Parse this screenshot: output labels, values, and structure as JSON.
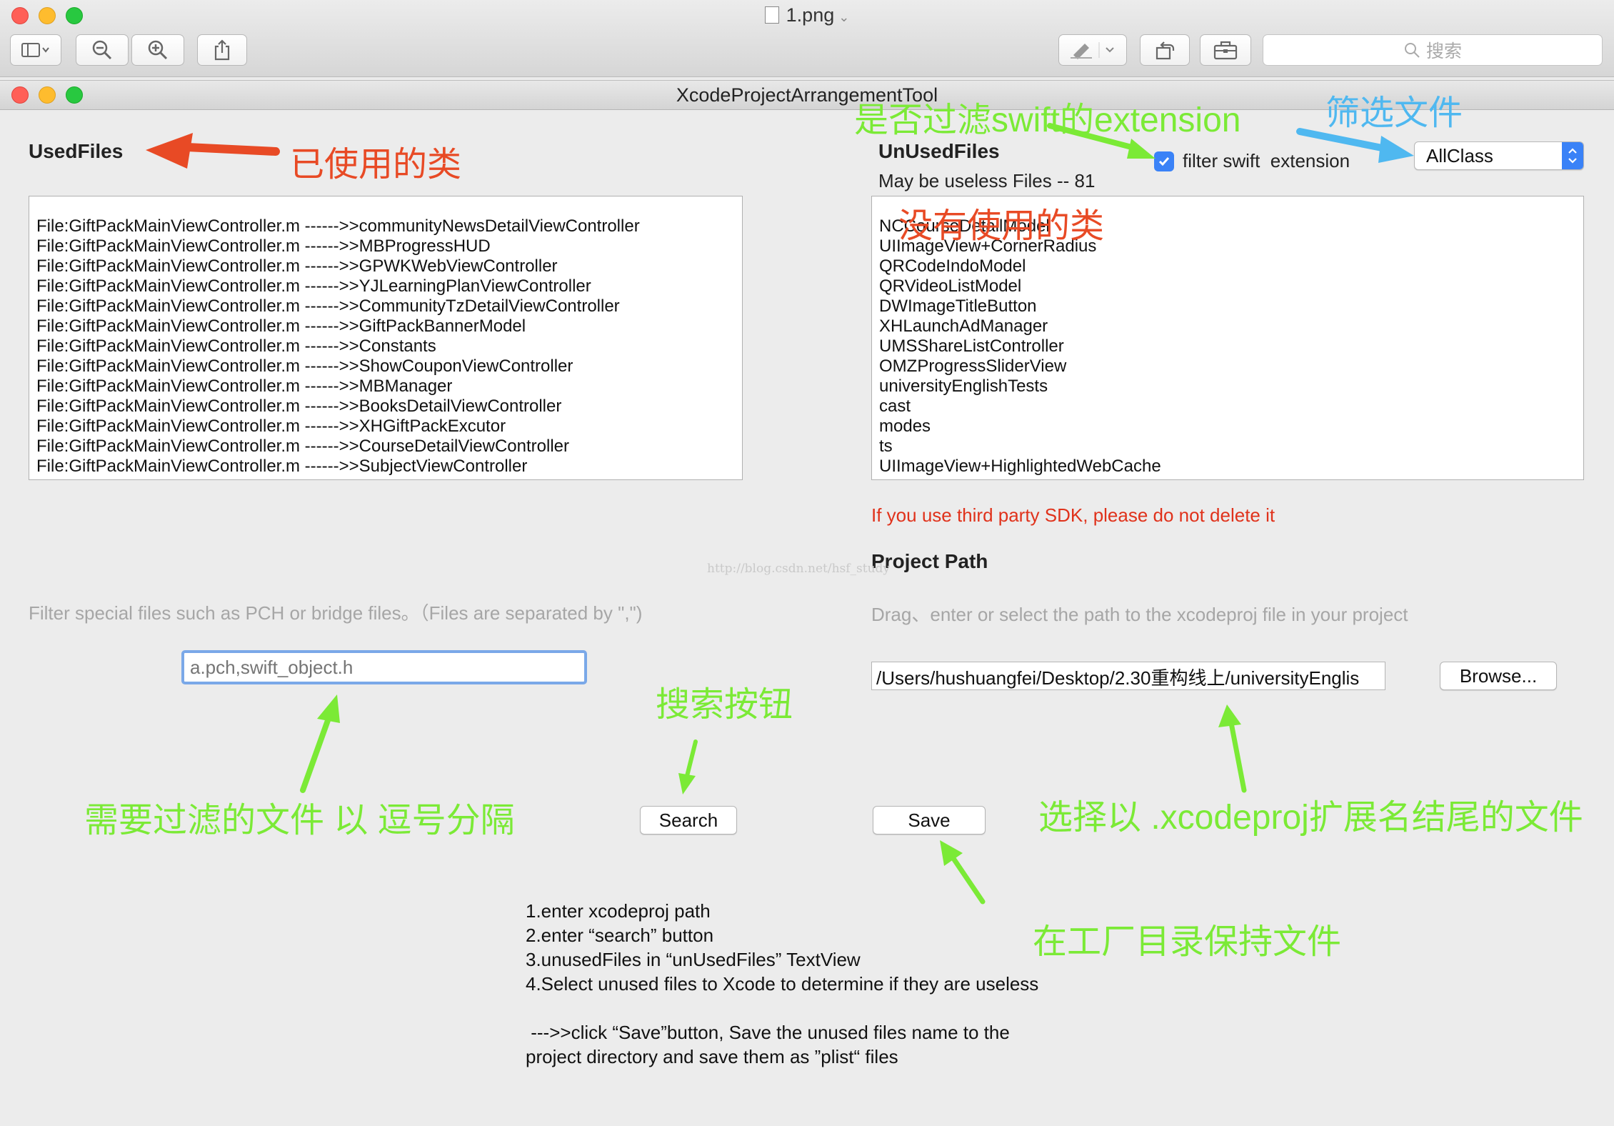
{
  "preview_window": {
    "title": "1.png",
    "search_placeholder": "搜索"
  },
  "app": {
    "title": "XcodeProjectArrangementTool",
    "used_files": {
      "heading": "UsedFiles",
      "rows": [
        "File:GiftPackMainViewController.m ------>>communityNewsDetailViewController",
        "File:GiftPackMainViewController.m ------>>MBProgressHUD",
        "File:GiftPackMainViewController.m ------>>GPWKWebViewController",
        "File:GiftPackMainViewController.m ------>>YJLearningPlanViewController",
        "File:GiftPackMainViewController.m ------>>CommunityTzDetailViewController",
        "File:GiftPackMainViewController.m ------>>GiftPackBannerModel",
        "File:GiftPackMainViewController.m ------>>Constants",
        "File:GiftPackMainViewController.m ------>>ShowCouponViewController",
        "File:GiftPackMainViewController.m ------>>MBManager",
        "File:GiftPackMainViewController.m ------>>BooksDetailViewController",
        "File:GiftPackMainViewController.m ------>>XHGiftPackExcutor",
        "File:GiftPackMainViewController.m ------>>CourseDetailViewController",
        "File:GiftPackMainViewController.m ------>>SubjectViewController"
      ]
    },
    "unused_files": {
      "heading": "UnUsedFiles",
      "count_label": "May be useless Files -- 81",
      "filter_checkbox_label": "filter swift  extension",
      "filter_checked": true,
      "class_select_value": "AllClass",
      "rows": [
        "NCCourseDetailModel",
        "UIImageView+CornerRadius",
        "QRCodeIndoModel",
        "QRVideoListModel",
        "DWImageTitleButton",
        "XHLaunchAdManager",
        "UMSShareListController",
        "OMZProgressSliderView",
        "universityEnglishTests",
        "cast",
        "modes",
        "ts",
        "UIImageView+HighlightedWebCache"
      ]
    },
    "warning": "If you use third party SDK, please do not delete it",
    "project_path": {
      "heading": "Project Path",
      "hint": "Drag、enter or select the path to the xcodeproj file in your project",
      "value": "/Users/hushuangfei/Desktop/2.30重构线上/universityEnglis",
      "browse_label": "Browse..."
    },
    "filter": {
      "hint": "Filter special files such as PCH or bridge files。（Files are separated by \",\")",
      "placeholder": "a.pch,swift_object.h"
    },
    "search_label": "Search",
    "save_label": "Save",
    "watermark": "http://blog.csdn.net/hsf_study",
    "instructions": "1.enter xcodeproj path\n2.enter “search” button\n3.unusedFiles in “unUsedFiles” TextView\n4.Select unused files to Xcode to determine if they are useless\n\n --->>click “Save”button, Save the unused files name to the\nproject directory and save them as ”plist“ files"
  },
  "annotations": {
    "used_classes": "已使用的类",
    "filter_swift_extension": "是否过滤swift的extension",
    "filter_files": "筛选文件",
    "unused_classes": "没有使用的类",
    "search_button": "搜索按钮",
    "filter_input": "需要过滤的文件 以 逗号分隔",
    "choose_xcodeproj": "选择以 .xcodeproj扩展名结尾的文件",
    "save_in_project_dir": "在工厂目录保持文件"
  },
  "colors": {
    "annotation_red": "#e84a25",
    "annotation_green": "#7bea36",
    "annotation_blue": "#4fb8f0",
    "focus_ring": "#7aa8e8",
    "checkbox_blue": "#3a82f7"
  }
}
